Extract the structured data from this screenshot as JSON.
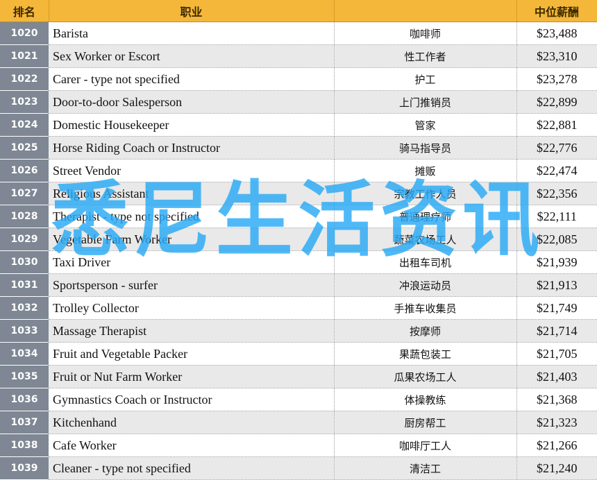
{
  "table": {
    "headers": {
      "rank": "排名",
      "occupation": "职业",
      "occupation_zh": "",
      "salary": "中位薪酬"
    },
    "rows": [
      {
        "rank": "1020",
        "en": "Barista",
        "zh": "咖啡师",
        "salary": "$23,488"
      },
      {
        "rank": "1021",
        "en": "Sex Worker or Escort",
        "zh": "性工作者",
        "salary": "$23,310"
      },
      {
        "rank": "1022",
        "en": "Carer - type not specified",
        "zh": "护工",
        "salary": "$23,278"
      },
      {
        "rank": "1023",
        "en": "Door-to-door Salesperson",
        "zh": "上门推销员",
        "salary": "$22,899"
      },
      {
        "rank": "1024",
        "en": "Domestic Housekeeper",
        "zh": "管家",
        "salary": "$22,881"
      },
      {
        "rank": "1025",
        "en": "Horse Riding Coach or Instructor",
        "zh": "骑马指导员",
        "salary": "$22,776"
      },
      {
        "rank": "1026",
        "en": "Street Vendor",
        "zh": "摊贩",
        "salary": "$22,474"
      },
      {
        "rank": "1027",
        "en": "Religious Assistant",
        "zh": "宗教工作人员",
        "salary": "$22,356"
      },
      {
        "rank": "1028",
        "en": "Therapist - type not specified",
        "zh": "普通理疗师",
        "salary": "$22,111"
      },
      {
        "rank": "1029",
        "en": "Vegetable Farm Worker",
        "zh": "蔬菜农场工人",
        "salary": "$22,085"
      },
      {
        "rank": "1030",
        "en": "Taxi Driver",
        "zh": "出租车司机",
        "salary": "$21,939"
      },
      {
        "rank": "1031",
        "en": "Sportsperson - surfer",
        "zh": "冲浪运动员",
        "salary": "$21,913"
      },
      {
        "rank": "1032",
        "en": "Trolley Collector",
        "zh": "手推车收集员",
        "salary": "$21,749"
      },
      {
        "rank": "1033",
        "en": "Massage Therapist",
        "zh": "按摩师",
        "salary": "$21,714"
      },
      {
        "rank": "1034",
        "en": "Fruit and Vegetable Packer",
        "zh": "果蔬包装工",
        "salary": "$21,705"
      },
      {
        "rank": "1035",
        "en": "Fruit or Nut Farm Worker",
        "zh": "瓜果农场工人",
        "salary": "$21,403"
      },
      {
        "rank": "1036",
        "en": "Gymnastics Coach or Instructor",
        "zh": "体操教练",
        "salary": "$21,368"
      },
      {
        "rank": "1037",
        "en": "Kitchenhand",
        "zh": "厨房帮工",
        "salary": "$21,323"
      },
      {
        "rank": "1038",
        "en": "Cafe Worker",
        "zh": "咖啡厅工人",
        "salary": "$21,266"
      },
      {
        "rank": "1039",
        "en": "Cleaner - type not specified",
        "zh": "清洁工",
        "salary": "$21,240"
      }
    ]
  },
  "watermark": {
    "text": "悉尼生活资讯",
    "color": "#28aaf5"
  },
  "colors": {
    "header_bg": "#f5b73a",
    "rank_bg": "#7e8793",
    "stripe_bg": "#e9e9e9"
  }
}
